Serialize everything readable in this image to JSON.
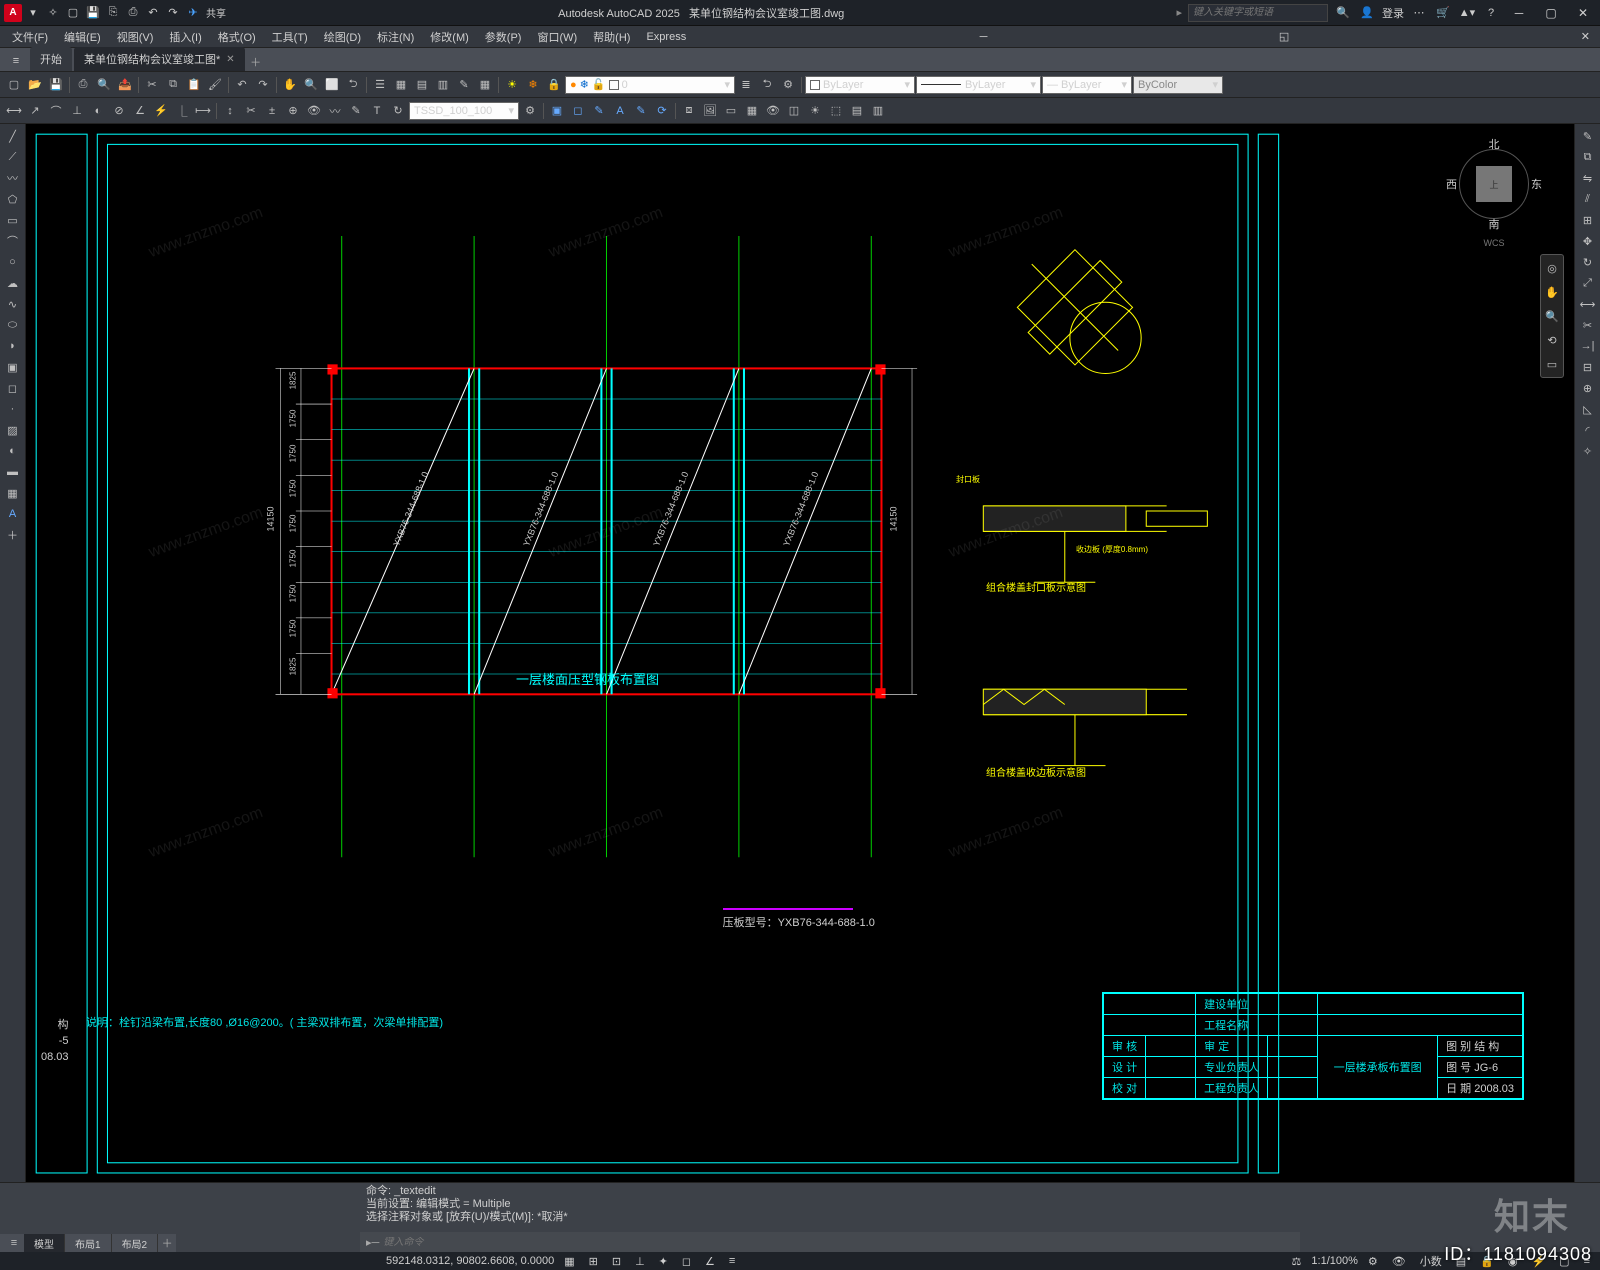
{
  "app": {
    "title_prefix": "Autodesk AutoCAD 2025",
    "document": "某单位钢结构会议室竣工图.dwg",
    "logo_letter": "A"
  },
  "search": {
    "placeholder": "键入关键字或短语"
  },
  "login": {
    "label": "登录"
  },
  "menubar": [
    "文件(F)",
    "编辑(E)",
    "视图(V)",
    "插入(I)",
    "格式(O)",
    "工具(T)",
    "绘图(D)",
    "标注(N)",
    "修改(M)",
    "参数(P)",
    "窗口(W)",
    "帮助(H)",
    "Express"
  ],
  "ribbon_tabs": {
    "start": "开始",
    "doc": "某单位钢结构会议室竣工图*"
  },
  "toolbar2": {
    "layer_value": "0",
    "bylayer1": "ByLayer",
    "bylayer2": "ByLayer",
    "bylayer3": "ByLayer",
    "bycolor": "ByColor"
  },
  "toolbar3": {
    "style": "TSSD_100_100"
  },
  "viewcube": {
    "face": "上",
    "n": "北",
    "s": "南",
    "e": "东",
    "w": "西",
    "wcs": "WCS"
  },
  "drawing": {
    "main_title": "一层楼面压型钢板布置图",
    "panel_text": "YXB76-344-688-1.0",
    "dim_total": "14150",
    "dim_edge": "1825",
    "dim_mid": "1750",
    "detail1": "组合楼盖封口板示意图",
    "detail2": "组合楼盖收边板示意图",
    "detail_sub1": "封口板",
    "detail_sub2": "收边板 (厚度0.8mm)",
    "press_model_label": "压板型号：YXB76-344-688-1.0",
    "note": "说明：栓钉沿梁布置,长度80 ,Ø16@200。( 主梁双排布置，次梁单排配置)"
  },
  "titleblock": {
    "row_build": "建设单位",
    "row_proj": "工程名称",
    "h1": "审 核",
    "h1b": "审 定",
    "h2": "设 计",
    "h2b": "专业负责人",
    "h3": "校 对",
    "h3b": "工程负责人",
    "sheet_title": "一层楼承板布置图",
    "col_tu": "图 别",
    "col_tu_v": "结 构",
    "col_no": "图 号",
    "col_no_v": "JG-6",
    "col_date": "日 期",
    "col_date_v": "2008.03",
    "prev_no": "-5",
    "prev_date": "08.03",
    "prev_cat": "构"
  },
  "cmdline": {
    "hist1": "命令: _textedit",
    "hist2": "当前设置: 编辑模式 = Multiple",
    "hist3": "选择注释对象或 [放弃(U)/模式(M)]: *取消*",
    "prompt": "▸─",
    "placeholder": "键入命令"
  },
  "layout_tabs": {
    "model": "模型",
    "l1": "布局1",
    "l2": "布局2"
  },
  "statusbar": {
    "coords": "592148.0312, 90802.6608, 0.0000",
    "scale": "1:1/100%",
    "decimal": "小数"
  },
  "watermark": {
    "id": "ID：1181094308",
    "logo": "知末",
    "url": "www.znzmo.com"
  }
}
